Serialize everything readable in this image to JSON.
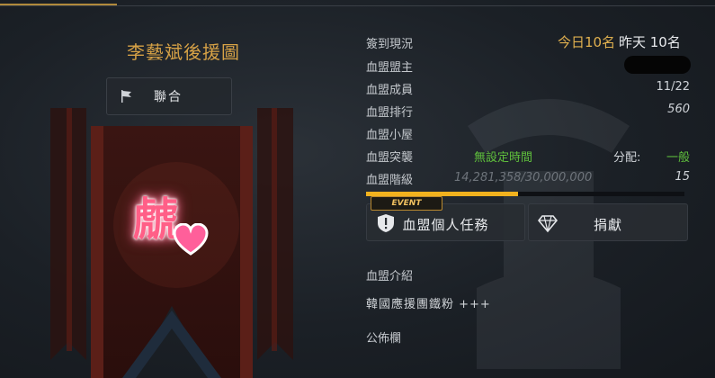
{
  "guild": {
    "name": "李藝斌後援圖",
    "alliance_label": "聯合"
  },
  "checkin": {
    "label": "簽到現況",
    "today": "今日10名",
    "yesterday": "昨天 10名"
  },
  "info": {
    "leader_label": "血盟盟主",
    "members_label": "血盟成員",
    "members_value": "11/22",
    "rank_label": "血盟排行",
    "rank_value": "560",
    "house_label": "血盟小屋",
    "raid_label": "血盟突襲",
    "raid_value": "無設定時間",
    "distribution_label": "分配:",
    "distribution_value": "一般",
    "level_label": "血盟階級",
    "exp_value": "14,281,358/30,000,000",
    "level_value": "15",
    "exp_progress": 0.476
  },
  "event_tag": "EVENT",
  "buttons": {
    "personal_quest": "血盟個人任務",
    "donate": "捐獻"
  },
  "intro": {
    "label": "血盟介紹",
    "text": "韓國應援團鐵粉 +++"
  },
  "notice": {
    "label": "公佈欄"
  },
  "emblem": {
    "text": "虤"
  },
  "colors": {
    "accent_gold": "#d7a246",
    "raid_green": "#5fbf3c",
    "progress": "#f2b21e"
  }
}
